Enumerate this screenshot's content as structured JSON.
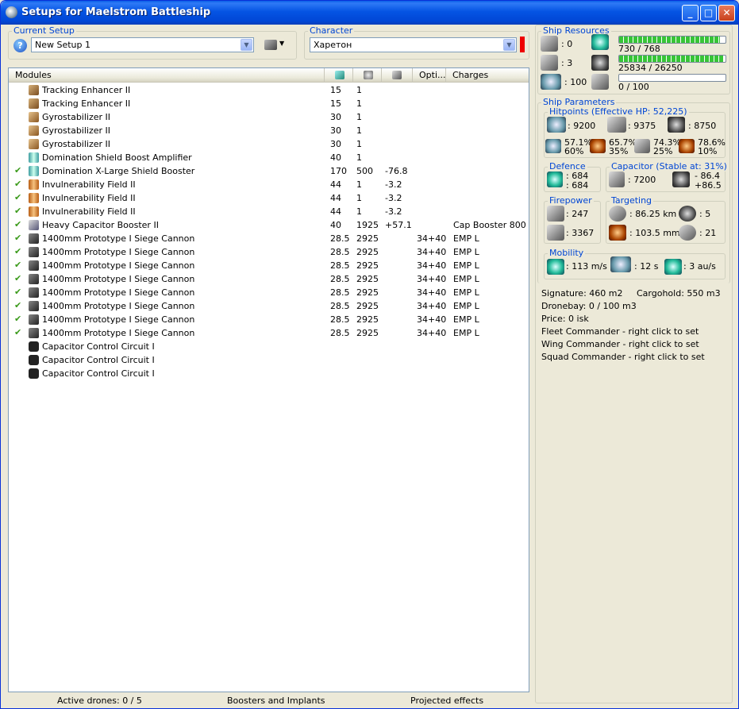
{
  "window": {
    "title": "Setups for Maelstrom Battleship",
    "btn_min": "_",
    "btn_max": "□",
    "btn_close": "✕"
  },
  "setup": {
    "label": "Current Setup",
    "value": "New Setup 1",
    "help": "?"
  },
  "character": {
    "label": "Character",
    "value": "Харетон"
  },
  "columns": {
    "modules": "Modules",
    "optimal": "Opti...",
    "charges": "Charges"
  },
  "modules": [
    {
      "check": "",
      "icon": "tracking-enhancer-icon",
      "name": "Tracking Enhancer II",
      "cpu": "15",
      "pg": "1",
      "cap": "",
      "optimal": "",
      "charge": ""
    },
    {
      "check": "",
      "icon": "tracking-enhancer-icon",
      "name": "Tracking Enhancer II",
      "cpu": "15",
      "pg": "1",
      "cap": "",
      "optimal": "",
      "charge": ""
    },
    {
      "check": "",
      "icon": "gyrostabilizer-icon",
      "name": "Gyrostabilizer II",
      "cpu": "30",
      "pg": "1",
      "cap": "",
      "optimal": "",
      "charge": ""
    },
    {
      "check": "",
      "icon": "gyrostabilizer-icon",
      "name": "Gyrostabilizer II",
      "cpu": "30",
      "pg": "1",
      "cap": "",
      "optimal": "",
      "charge": ""
    },
    {
      "check": "",
      "icon": "gyrostabilizer-icon",
      "name": "Gyrostabilizer II",
      "cpu": "30",
      "pg": "1",
      "cap": "",
      "optimal": "",
      "charge": ""
    },
    {
      "check": "",
      "icon": "shield-amplifier-icon",
      "name": "Domination Shield Boost Amplifier",
      "cpu": "40",
      "pg": "1",
      "cap": "",
      "optimal": "",
      "charge": ""
    },
    {
      "check": "✔",
      "icon": "shield-booster-icon",
      "name": "Domination X-Large Shield Booster",
      "cpu": "170",
      "pg": "500",
      "cap": "-76.8",
      "optimal": "",
      "charge": ""
    },
    {
      "check": "✔",
      "icon": "invulnerability-field-icon",
      "name": "Invulnerability Field II",
      "cpu": "44",
      "pg": "1",
      "cap": "-3.2",
      "optimal": "",
      "charge": ""
    },
    {
      "check": "✔",
      "icon": "invulnerability-field-icon",
      "name": "Invulnerability Field II",
      "cpu": "44",
      "pg": "1",
      "cap": "-3.2",
      "optimal": "",
      "charge": ""
    },
    {
      "check": "✔",
      "icon": "invulnerability-field-icon",
      "name": "Invulnerability Field II",
      "cpu": "44",
      "pg": "1",
      "cap": "-3.2",
      "optimal": "",
      "charge": ""
    },
    {
      "check": "✔",
      "icon": "capacitor-booster-icon",
      "name": "Heavy Capacitor Booster II",
      "cpu": "40",
      "pg": "1925",
      "cap": "+57.1",
      "optimal": "",
      "charge": "Cap Booster 800"
    },
    {
      "check": "✔",
      "icon": "siege-cannon-icon",
      "name": "1400mm Prototype I Siege Cannon",
      "cpu": "28.5",
      "pg": "2925",
      "cap": "",
      "optimal": "34+40",
      "charge": "EMP L"
    },
    {
      "check": "✔",
      "icon": "siege-cannon-icon",
      "name": "1400mm Prototype I Siege Cannon",
      "cpu": "28.5",
      "pg": "2925",
      "cap": "",
      "optimal": "34+40",
      "charge": "EMP L"
    },
    {
      "check": "✔",
      "icon": "siege-cannon-icon",
      "name": "1400mm Prototype I Siege Cannon",
      "cpu": "28.5",
      "pg": "2925",
      "cap": "",
      "optimal": "34+40",
      "charge": "EMP L"
    },
    {
      "check": "✔",
      "icon": "siege-cannon-icon",
      "name": "1400mm Prototype I Siege Cannon",
      "cpu": "28.5",
      "pg": "2925",
      "cap": "",
      "optimal": "34+40",
      "charge": "EMP L"
    },
    {
      "check": "✔",
      "icon": "siege-cannon-icon",
      "name": "1400mm Prototype I Siege Cannon",
      "cpu": "28.5",
      "pg": "2925",
      "cap": "",
      "optimal": "34+40",
      "charge": "EMP L"
    },
    {
      "check": "✔",
      "icon": "siege-cannon-icon",
      "name": "1400mm Prototype I Siege Cannon",
      "cpu": "28.5",
      "pg": "2925",
      "cap": "",
      "optimal": "34+40",
      "charge": "EMP L"
    },
    {
      "check": "✔",
      "icon": "siege-cannon-icon",
      "name": "1400mm Prototype I Siege Cannon",
      "cpu": "28.5",
      "pg": "2925",
      "cap": "",
      "optimal": "34+40",
      "charge": "EMP L"
    },
    {
      "check": "✔",
      "icon": "siege-cannon-icon",
      "name": "1400mm Prototype I Siege Cannon",
      "cpu": "28.5",
      "pg": "2925",
      "cap": "",
      "optimal": "34+40",
      "charge": "EMP L"
    },
    {
      "check": "",
      "icon": "capacitor-control-circuit-icon",
      "name": "Capacitor Control Circuit I",
      "cpu": "",
      "pg": "",
      "cap": "",
      "optimal": "",
      "charge": ""
    },
    {
      "check": "",
      "icon": "capacitor-control-circuit-icon",
      "name": "Capacitor Control Circuit I",
      "cpu": "",
      "pg": "",
      "cap": "",
      "optimal": "",
      "charge": ""
    },
    {
      "check": "",
      "icon": "capacitor-control-circuit-icon",
      "name": "Capacitor Control Circuit I",
      "cpu": "",
      "pg": "",
      "cap": "",
      "optimal": "",
      "charge": ""
    }
  ],
  "status": {
    "drones": "Active drones: 0 / 5",
    "boosters": "Boosters and Implants",
    "projected": "Projected effects"
  },
  "resources": {
    "label": "Ship Resources",
    "turrets": ": 0",
    "launchers": ": 3",
    "calibration": ": 100",
    "cpu": "730 / 768",
    "cpu_fill": 0.95,
    "powergrid": "25834 / 26250",
    "powergrid_fill": 0.98,
    "drone_bw": "0 / 100",
    "drone_bw_fill": 0
  },
  "params": {
    "label": "Ship Parameters"
  },
  "hitpoints": {
    "label": "Hitpoints (Effective HP: 52,225)",
    "shield": ": 9200",
    "armor": ": 9375",
    "structure": ": 8750",
    "em_shield": "57.1%",
    "em_armor": "60%",
    "th_shield": "65.7%",
    "th_armor": "35%",
    "kin_shield": "74.3%",
    "kin_armor": "25%",
    "exp_shield": "78.6%",
    "exp_armor": "10%"
  },
  "defence": {
    "label": "Defence",
    "a": ": 684",
    "b": ": 684"
  },
  "capacitor": {
    "label": "Capacitor (Stable at: 31%)",
    "capacity": ": 7200",
    "delta_a": "- 86.4",
    "delta_b": "+86.5"
  },
  "firepower": {
    "label": "Firepower",
    "turret_dps": ": 247",
    "volley": ": 3367"
  },
  "targeting": {
    "label": "Targeting",
    "range": ": 86.25 km",
    "targets": ": 5",
    "scan": ": 103.5 mm",
    "sensor": ": 21"
  },
  "mobility": {
    "label": "Mobility",
    "speed": ": 113 m/s",
    "align": ": 12 s",
    "warp": ": 3 au/s"
  },
  "misc": {
    "signature": "Signature: 460 m2",
    "cargohold": "Cargohold: 550 m3",
    "dronebay": "Dronebay: 0 / 100 m3",
    "price": "Price: 0 isk",
    "fleet": "Fleet Commander - right click to set",
    "wing": "Wing Commander - right click to set",
    "squad": "Squad Commander - right click to set"
  }
}
